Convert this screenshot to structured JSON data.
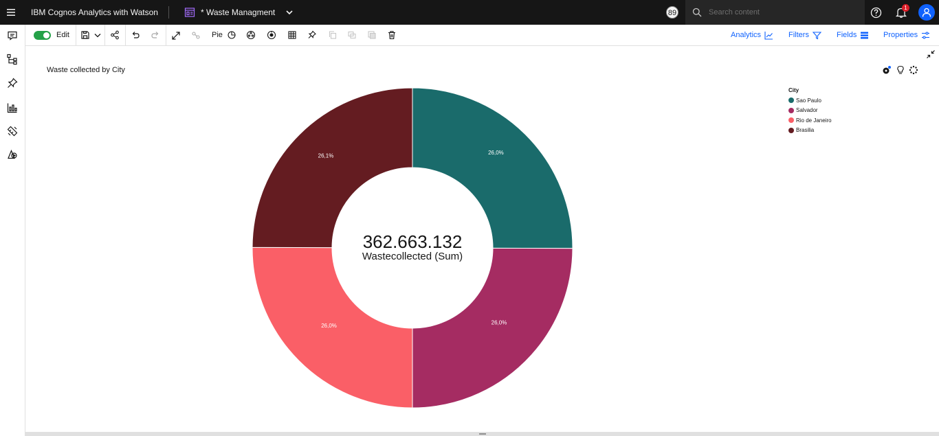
{
  "header": {
    "app_title": "IBM Cognos Analytics with Watson",
    "doc_title": "* Waste Managment",
    "activity_count": "89",
    "search_placeholder": "Search content",
    "notification_count": "1"
  },
  "toolbar": {
    "edit_label": "Edit",
    "edit_on": true,
    "chart_type_label": "Pie",
    "analytics_label": "Analytics",
    "filters_label": "Filters",
    "fields_label": "Fields",
    "properties_label": "Properties"
  },
  "left_rail": {
    "icons": [
      "comment-icon",
      "data-tree-icon",
      "pin-icon",
      "visualizations-icon",
      "widgets-icon",
      "media-icon"
    ]
  },
  "widget": {
    "title": "Waste collected by City",
    "tool_icons": [
      "smart-insights-icon",
      "lightbulb-icon",
      "more-icon"
    ]
  },
  "chart_data": {
    "type": "pie",
    "style": "donut",
    "center_value": "362.663.132",
    "center_label": "Wastecollected (Sum)",
    "legend_title": "City",
    "legend_position": "top-right",
    "slices": [
      {
        "name": "Sao Paulo",
        "percent": 26.0,
        "label": "26,0%",
        "color": "#1a6b6b"
      },
      {
        "name": "Salvador",
        "percent": 25.9,
        "label": "26,0%",
        "color": "#a52c62"
      },
      {
        "name": "Rio de Janeiro",
        "percent": 26.0,
        "label": "26,0%",
        "color": "#fa5f67"
      },
      {
        "name": "Brasilia",
        "percent": 25.9,
        "label": "26,1%",
        "color": "#641c21"
      }
    ]
  }
}
